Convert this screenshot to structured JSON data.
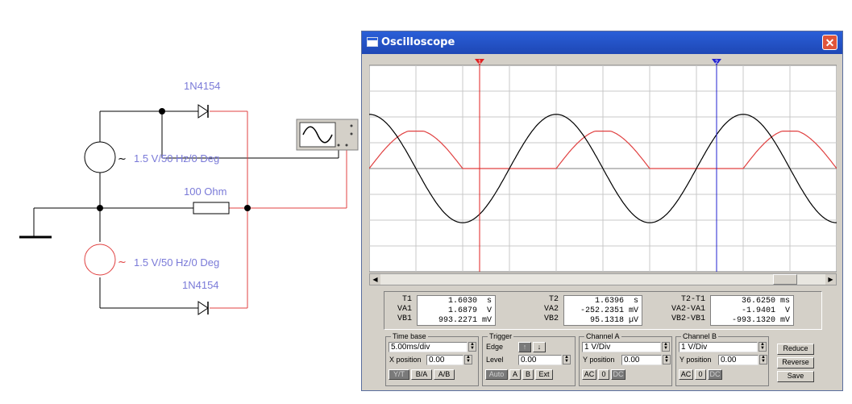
{
  "schematic": {
    "diode_top_label": "1N4154",
    "diode_bottom_label": "1N4154",
    "source_top_label": "1.5 V/50 Hz/0 Deg",
    "source_bottom_label": "1.5 V/50 Hz/0 Deg",
    "resistor_label": "100  Ohm",
    "colors": {
      "wire_black": "#000000",
      "wire_red": "#e04040",
      "label": "#7a7ad8"
    }
  },
  "window": {
    "title": "Oscilloscope",
    "close_icon": "close-icon"
  },
  "screen": {
    "cursor1_label": "1",
    "cursor2_label": "2",
    "colors": {
      "grid": "#c8c8c8",
      "background": "#ffffff",
      "channel_a": "#e04040",
      "channel_b": "#000000",
      "cursor1": "#e02020",
      "cursor2": "#2020d0"
    }
  },
  "chart_data": {
    "type": "line",
    "title": "",
    "xlabel": "",
    "ylabel": "",
    "time_per_div_ms": 5,
    "volts_per_div": 1,
    "x_divisions": 10,
    "y_divisions": 8,
    "series": [
      {
        "name": "Channel A",
        "color": "#e04040",
        "description_values": "rectified sine, peak ~1.4 V, clipped at 0",
        "x_ms": [
          0,
          2.5,
          5,
          7.5,
          10,
          12.5,
          15,
          17.5,
          20,
          22.5,
          25,
          27.5,
          30,
          32.5,
          35,
          37.5,
          40,
          42.5,
          45,
          47.5,
          50
        ],
        "y": [
          0.25,
          1.3,
          1.45,
          1.3,
          0.2,
          0,
          0,
          0,
          0.25,
          1.3,
          1.45,
          1.3,
          0.2,
          0,
          0,
          0,
          0.25,
          1.3,
          1.45,
          1.3,
          0.2
        ]
      },
      {
        "name": "Channel B",
        "color": "#000000",
        "x_ms": [
          0,
          2.5,
          5,
          7.5,
          10,
          12.5,
          15,
          17.5,
          20,
          22.5,
          25,
          27.5,
          30,
          32.5,
          35,
          37.5,
          40,
          42.5,
          45,
          47.5,
          50
        ],
        "y": [
          2.1,
          1.4,
          0,
          -1.4,
          -2.1,
          -1.4,
          0,
          1.4,
          2.1,
          1.4,
          0,
          -1.4,
          -2.1,
          -1.4,
          0,
          1.4,
          2.1,
          1.4,
          0,
          -1.4,
          -2.1
        ]
      }
    ],
    "ylim": [
      -4,
      4
    ],
    "grid": true
  },
  "readout": {
    "t1": {
      "t_label": "T1",
      "t_value": "1.6030",
      "t_unit": "s",
      "va_label": "VA1",
      "va_value": "1.6879",
      "va_unit": "V",
      "vb_label": "VB1",
      "vb_value": "993.2271",
      "vb_unit": "mV"
    },
    "t2": {
      "t_label": "T2",
      "t_value": "1.6396",
      "t_unit": "s",
      "va_label": "VA2",
      "va_value": "-252.2351",
      "va_unit": "mV",
      "vb_label": "VB2",
      "vb_value": "95.1318",
      "vb_unit": "µV"
    },
    "diff": {
      "t_label": "T2-T1",
      "t_value": "36.6250",
      "t_unit": "ms",
      "va_label": "VA2-VA1",
      "va_value": "-1.9401",
      "va_unit": "V",
      "vb_label": "VB2-VB1",
      "vb_value": "-993.1320",
      "vb_unit": "mV"
    }
  },
  "timebase": {
    "title": "Time base",
    "value": "5.00ms/div",
    "xpos_label": "X position",
    "xpos_value": "0.00",
    "btn_yt": "Y/T",
    "btn_ba": "B/A",
    "btn_ab": "A/B"
  },
  "trigger": {
    "title": "Trigger",
    "edge_label": "Edge",
    "level_label": "Level",
    "level_value": "0.00",
    "btn_auto": "Auto",
    "btn_a": "A",
    "btn_b": "B",
    "btn_ext": "Ext"
  },
  "channel_a": {
    "title": "Channel A",
    "value": "1  V/Div",
    "ypos_label": "Y position",
    "ypos_value": "0.00",
    "btn_ac": "AC",
    "btn_0": "0",
    "btn_dc": "DC"
  },
  "channel_b": {
    "title": "Channel B",
    "value": "1  V/Div",
    "ypos_label": "Y position",
    "ypos_value": "0.00",
    "btn_ac": "AC",
    "btn_0": "0",
    "btn_dc": "DC"
  },
  "side_buttons": {
    "reduce": "Reduce",
    "reverse": "Reverse",
    "save": "Save"
  }
}
